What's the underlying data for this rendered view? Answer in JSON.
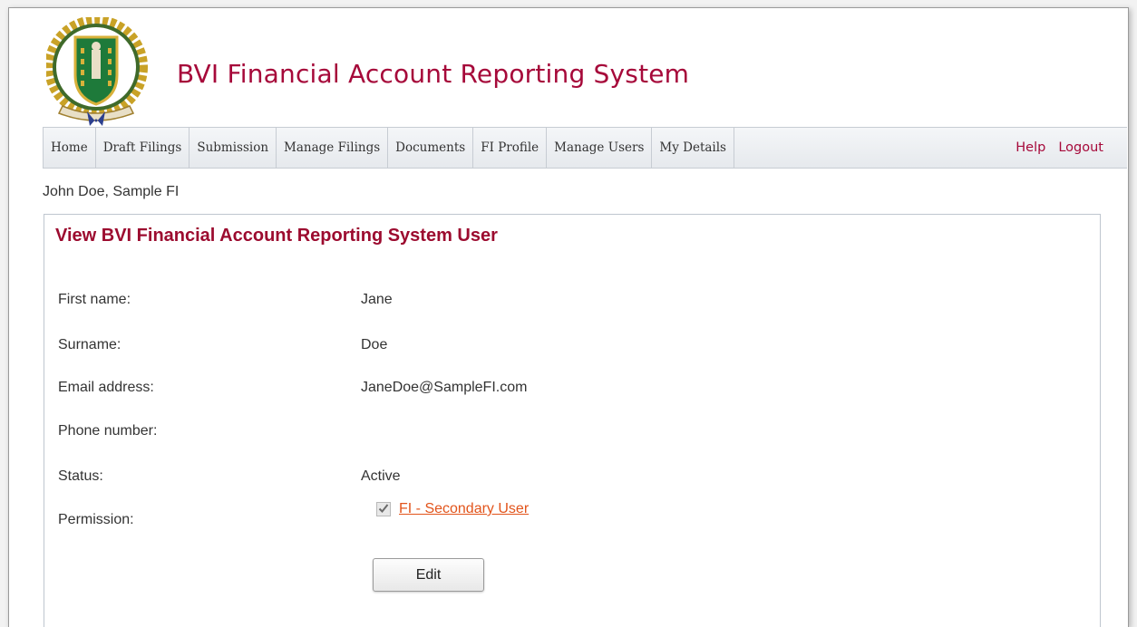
{
  "header": {
    "title": "BVI Financial Account Reporting System"
  },
  "nav": {
    "items": [
      "Home",
      "Draft Filings",
      "Submission",
      "Manage Filings",
      "Documents",
      "FI Profile",
      "Manage Users",
      "My Details"
    ],
    "help": "Help",
    "logout": "Logout"
  },
  "user_line": "John Doe, Sample FI",
  "panel": {
    "title": "View BVI Financial Account Reporting System User",
    "fields": {
      "first_name": {
        "label": "First name:",
        "value": "Jane"
      },
      "surname": {
        "label": "Surname:",
        "value": "Doe"
      },
      "email": {
        "label": "Email address:",
        "value": "JaneDoe@SampleFI.com"
      },
      "phone": {
        "label": "Phone number:",
        "value": ""
      },
      "status": {
        "label": "Status:",
        "value": "Active"
      },
      "permission": {
        "label": "Permission:",
        "value": "FI - Secondary User",
        "checked": true
      }
    },
    "edit_label": "Edit"
  },
  "colors": {
    "brand": "#a6093a",
    "link": "#e2541b"
  },
  "icons": {
    "logo": "bvi-coat-of-arms-icon",
    "checkbox": "checkmark-icon"
  }
}
